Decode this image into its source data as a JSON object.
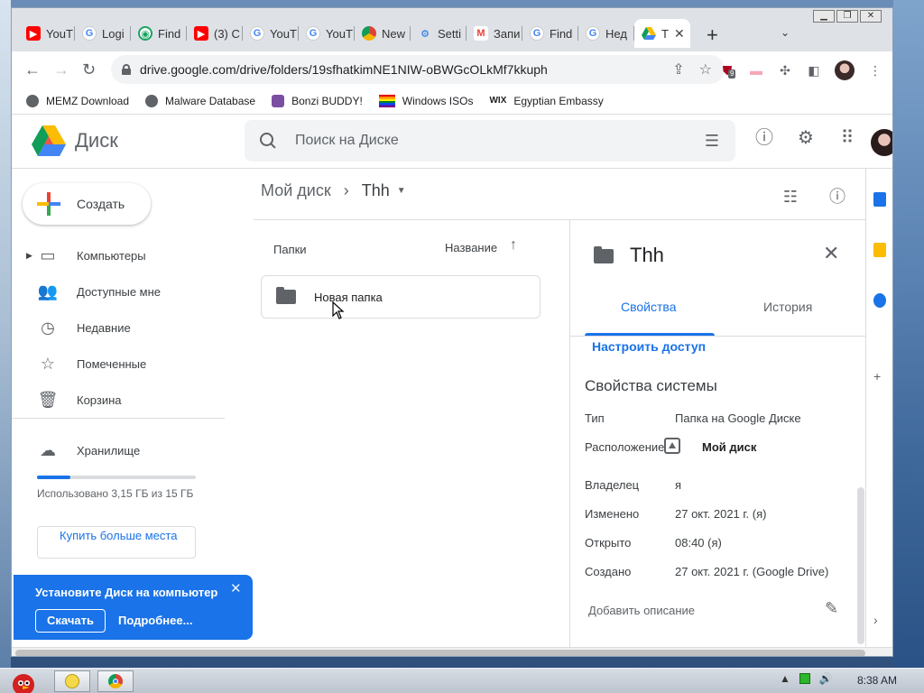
{
  "browser": {
    "tabs": [
      {
        "label": "YouT",
        "icon": "youtube-icon"
      },
      {
        "label": "Logi",
        "icon": "google-icon"
      },
      {
        "label": "Find",
        "icon": "find-icon"
      },
      {
        "label": "(3) C",
        "icon": "youtube-icon"
      },
      {
        "label": "YouT",
        "icon": "google-icon"
      },
      {
        "label": "YouT",
        "icon": "google-icon"
      },
      {
        "label": "New",
        "icon": "chrome-icon"
      },
      {
        "label": "Setti",
        "icon": "gear-icon"
      },
      {
        "label": "Запи",
        "icon": "gmail-icon"
      },
      {
        "label": "Find",
        "icon": "google-icon"
      },
      {
        "label": "Нед",
        "icon": "google-icon"
      }
    ],
    "active_tab": {
      "label": "Т",
      "icon": "drive-icon",
      "close": "✕"
    },
    "new_tab": "+",
    "url": "drive.google.com/drive/folders/19sfhatkimNE1NIW-oBWGcOLkMf7kkuph",
    "extension_badge": "9",
    "bookmarks": [
      {
        "label": "MEMZ Download"
      },
      {
        "label": "Malware Database"
      },
      {
        "label": "Bonzi BUDDY!"
      },
      {
        "label": "Windows ISOs"
      },
      {
        "label": "Egyptian Embassy",
        "prefix": "WIX"
      }
    ]
  },
  "drive": {
    "app_name": "Диск",
    "search_placeholder": "Поиск на Диске",
    "create_label": "Создать",
    "nav": [
      {
        "label": "Компьютеры",
        "icon": "computer-icon"
      },
      {
        "label": "Доступные мне",
        "icon": "shared-users-icon"
      },
      {
        "label": "Недавние",
        "icon": "clock-icon"
      },
      {
        "label": "Помеченные",
        "icon": "star-icon"
      },
      {
        "label": "Корзина",
        "icon": "trash-icon"
      }
    ],
    "storage": {
      "label": "Хранилище",
      "usage_text": "Использовано 3,15 ГБ из 15 ГБ",
      "used_fraction": 0.21,
      "buy_label": "Купить больше места"
    },
    "install_banner": {
      "title": "Установите Диск на компьютер",
      "download_label": "Скачать",
      "more_label": "Подробнее..."
    },
    "breadcrumb": {
      "root": "Мой диск",
      "current": "Thh"
    },
    "folders_section_label": "Папки",
    "sort_label": "Название",
    "folders": [
      {
        "name": "Новая папка"
      }
    ],
    "details": {
      "title": "Thh",
      "tabs": [
        "Свойства",
        "История"
      ],
      "share_link": "Настроить доступ",
      "system_heading": "Свойства системы",
      "rows": [
        {
          "key": "Тип",
          "value": "Папка на Google Диске"
        },
        {
          "key": "Расположение",
          "value": "Мой диск"
        },
        {
          "key": "Владелец",
          "value": "я"
        },
        {
          "key": "Изменено",
          "value": "27 окт. 2021 г. (я)"
        },
        {
          "key": "Открыто",
          "value": "08:40 (я)"
        },
        {
          "key": "Создано",
          "value": "27 окт. 2021 г. (Google Drive)"
        }
      ],
      "add_description": "Добавить описание"
    }
  },
  "taskbar": {
    "clock": "8:38 AM"
  },
  "colors": {
    "accent": "#1a73e8",
    "install_banner": "#1a73e8"
  }
}
